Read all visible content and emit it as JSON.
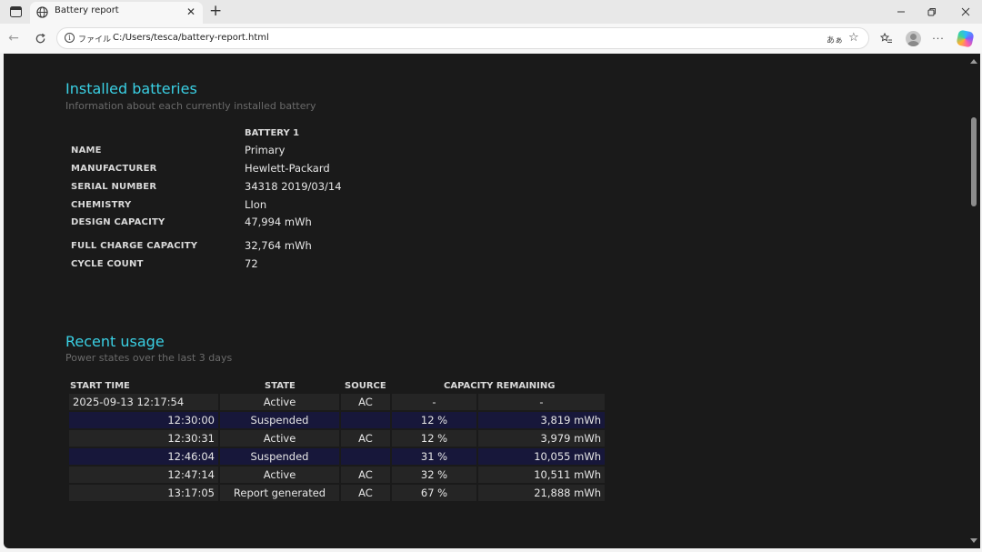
{
  "browser": {
    "tab_title": "Battery report",
    "scheme_label": "ファイル",
    "url": "C:/Users/tesca/battery-report.html",
    "read_aloud_label": "あぁ"
  },
  "installed": {
    "title": "Installed batteries",
    "subtitle": "Information about each currently installed battery",
    "column_header": "BATTERY 1",
    "rows": [
      {
        "label": "NAME",
        "value": "Primary"
      },
      {
        "label": "MANUFACTURER",
        "value": "Hewlett-Packard"
      },
      {
        "label": "SERIAL NUMBER",
        "value": "34318 2019/03/14"
      },
      {
        "label": "CHEMISTRY",
        "value": "LIon"
      },
      {
        "label": "DESIGN CAPACITY",
        "value": "47,994 mWh"
      },
      {
        "label": "FULL CHARGE CAPACITY",
        "value": "32,764 mWh"
      },
      {
        "label": "CYCLE COUNT",
        "value": "72"
      }
    ]
  },
  "recent": {
    "title": "Recent usage",
    "subtitle": "Power states over the last 3 days",
    "headers": {
      "start_time": "START TIME",
      "state": "STATE",
      "source": "SOURCE",
      "capacity": "CAPACITY REMAINING"
    },
    "rows": [
      {
        "time": "2025-09-13  12:17:54",
        "state": "Active",
        "source": "AC",
        "pct": "-",
        "cap": "-"
      },
      {
        "time": "12:30:00",
        "state": "Suspended",
        "source": "",
        "pct": "12 %",
        "cap": "3,819 mWh"
      },
      {
        "time": "12:30:31",
        "state": "Active",
        "source": "AC",
        "pct": "12 %",
        "cap": "3,979 mWh"
      },
      {
        "time": "12:46:04",
        "state": "Suspended",
        "source": "",
        "pct": "31 %",
        "cap": "10,055 mWh"
      },
      {
        "time": "12:47:14",
        "state": "Active",
        "source": "AC",
        "pct": "32 %",
        "cap": "10,511 mWh"
      },
      {
        "time": "13:17:05",
        "state": "Report generated",
        "source": "AC",
        "pct": "67 %",
        "cap": "21,888 mWh"
      }
    ]
  },
  "colors": {
    "accent": "#3ad0e4",
    "page_background": "#1a1a1a",
    "row_alt": "#17173a"
  }
}
